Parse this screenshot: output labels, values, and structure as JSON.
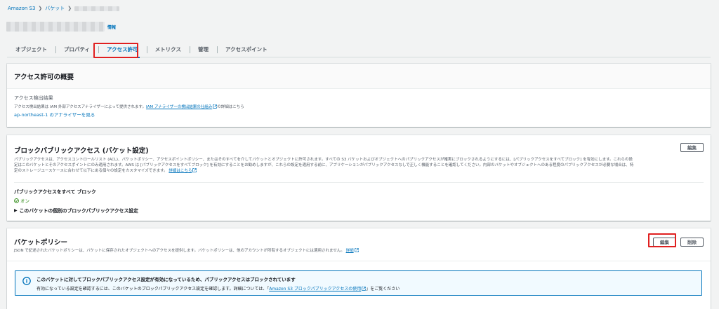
{
  "breadcrumb": {
    "items": [
      "Amazon S3",
      "バケット"
    ]
  },
  "title": {
    "info": "情報"
  },
  "tabs": [
    {
      "label": "オブジェクト"
    },
    {
      "label": "プロパティ"
    },
    {
      "label": "アクセス許可",
      "active": true
    },
    {
      "label": "メトリクス"
    },
    {
      "label": "管理"
    },
    {
      "label": "アクセスポイント"
    }
  ],
  "overview": {
    "title": "アクセス許可の概要",
    "findings_label": "アクセス検出結果",
    "findings_text_before": "アクセス検出結果は IAM 外部アクセスアナライザーによって提供されます。",
    "findings_link": "IAM アナライザーの検出結果の仕組み",
    "findings_text_after": "の詳細はこちら",
    "analyzer_link": "ap-northeast-1 のアナライザーを見る"
  },
  "block_public": {
    "title": "ブロックパブリックアクセス (バケット設定)",
    "edit_label": "編集",
    "desc_line1": "パブリックアクセスは、アクセスコントロールリスト (ACL)、バケットポリシー、アクセスポイントポリシー、またはそのすべてを介してバケットとオブジェクトに許可されます。すべての S3 バケットおよびオブジェクトへのパブリックアクセスが確実にブロックされるようにするには、[パブリックアクセスをすべてブロック] を有効にします。これらの設",
    "desc_line2": "定はこのバケットとそのアクセスポイントにのみ適用されます。AWS は [パブリックアクセスをすべてブロック] を有効にすることをお勧めしますが、これらの設定を適用する前に、アプリケーションがパブリックアクセスなしで正しく機能することを確認してください。内部のバケットやオブジェクトへのある程度のパブリックアクセスが必要な場合は、特",
    "desc_line3": "定のストレージユースケースに合わせて以下にある個々の設定をカスタマイズできます。",
    "learn_more": "詳細はこちら",
    "block_all_label": "パブリックアクセスをすべて ブロック",
    "block_all_status": "オン",
    "individual_label": "このバケットの個別のブロックパブリックアクセス設定"
  },
  "bucket_policy": {
    "title": "バケットポリシー",
    "edit_label": "編集",
    "delete_label": "削除",
    "desc": "JSON で記述されたバケットポリシーは、バケットに保存されたオブジェクトへのアクセスを提供します。バケットポリシーは、他のアカウントが所有するオブジェクトには適用されません。",
    "learn_more": "詳細",
    "alert_title": "このバケットに対してブロックパブリックアクセス設定が有効になっているため、パブリックアクセスはブロックされています",
    "alert_body_before": "有効になっている設定を確認するには、このバケットのブロックパブリックアクセス設定を確認します。詳細については、「",
    "alert_link": "Amazon S3 ブロックパブリックアクセスの使用",
    "alert_body_after": "」をご覧ください"
  }
}
